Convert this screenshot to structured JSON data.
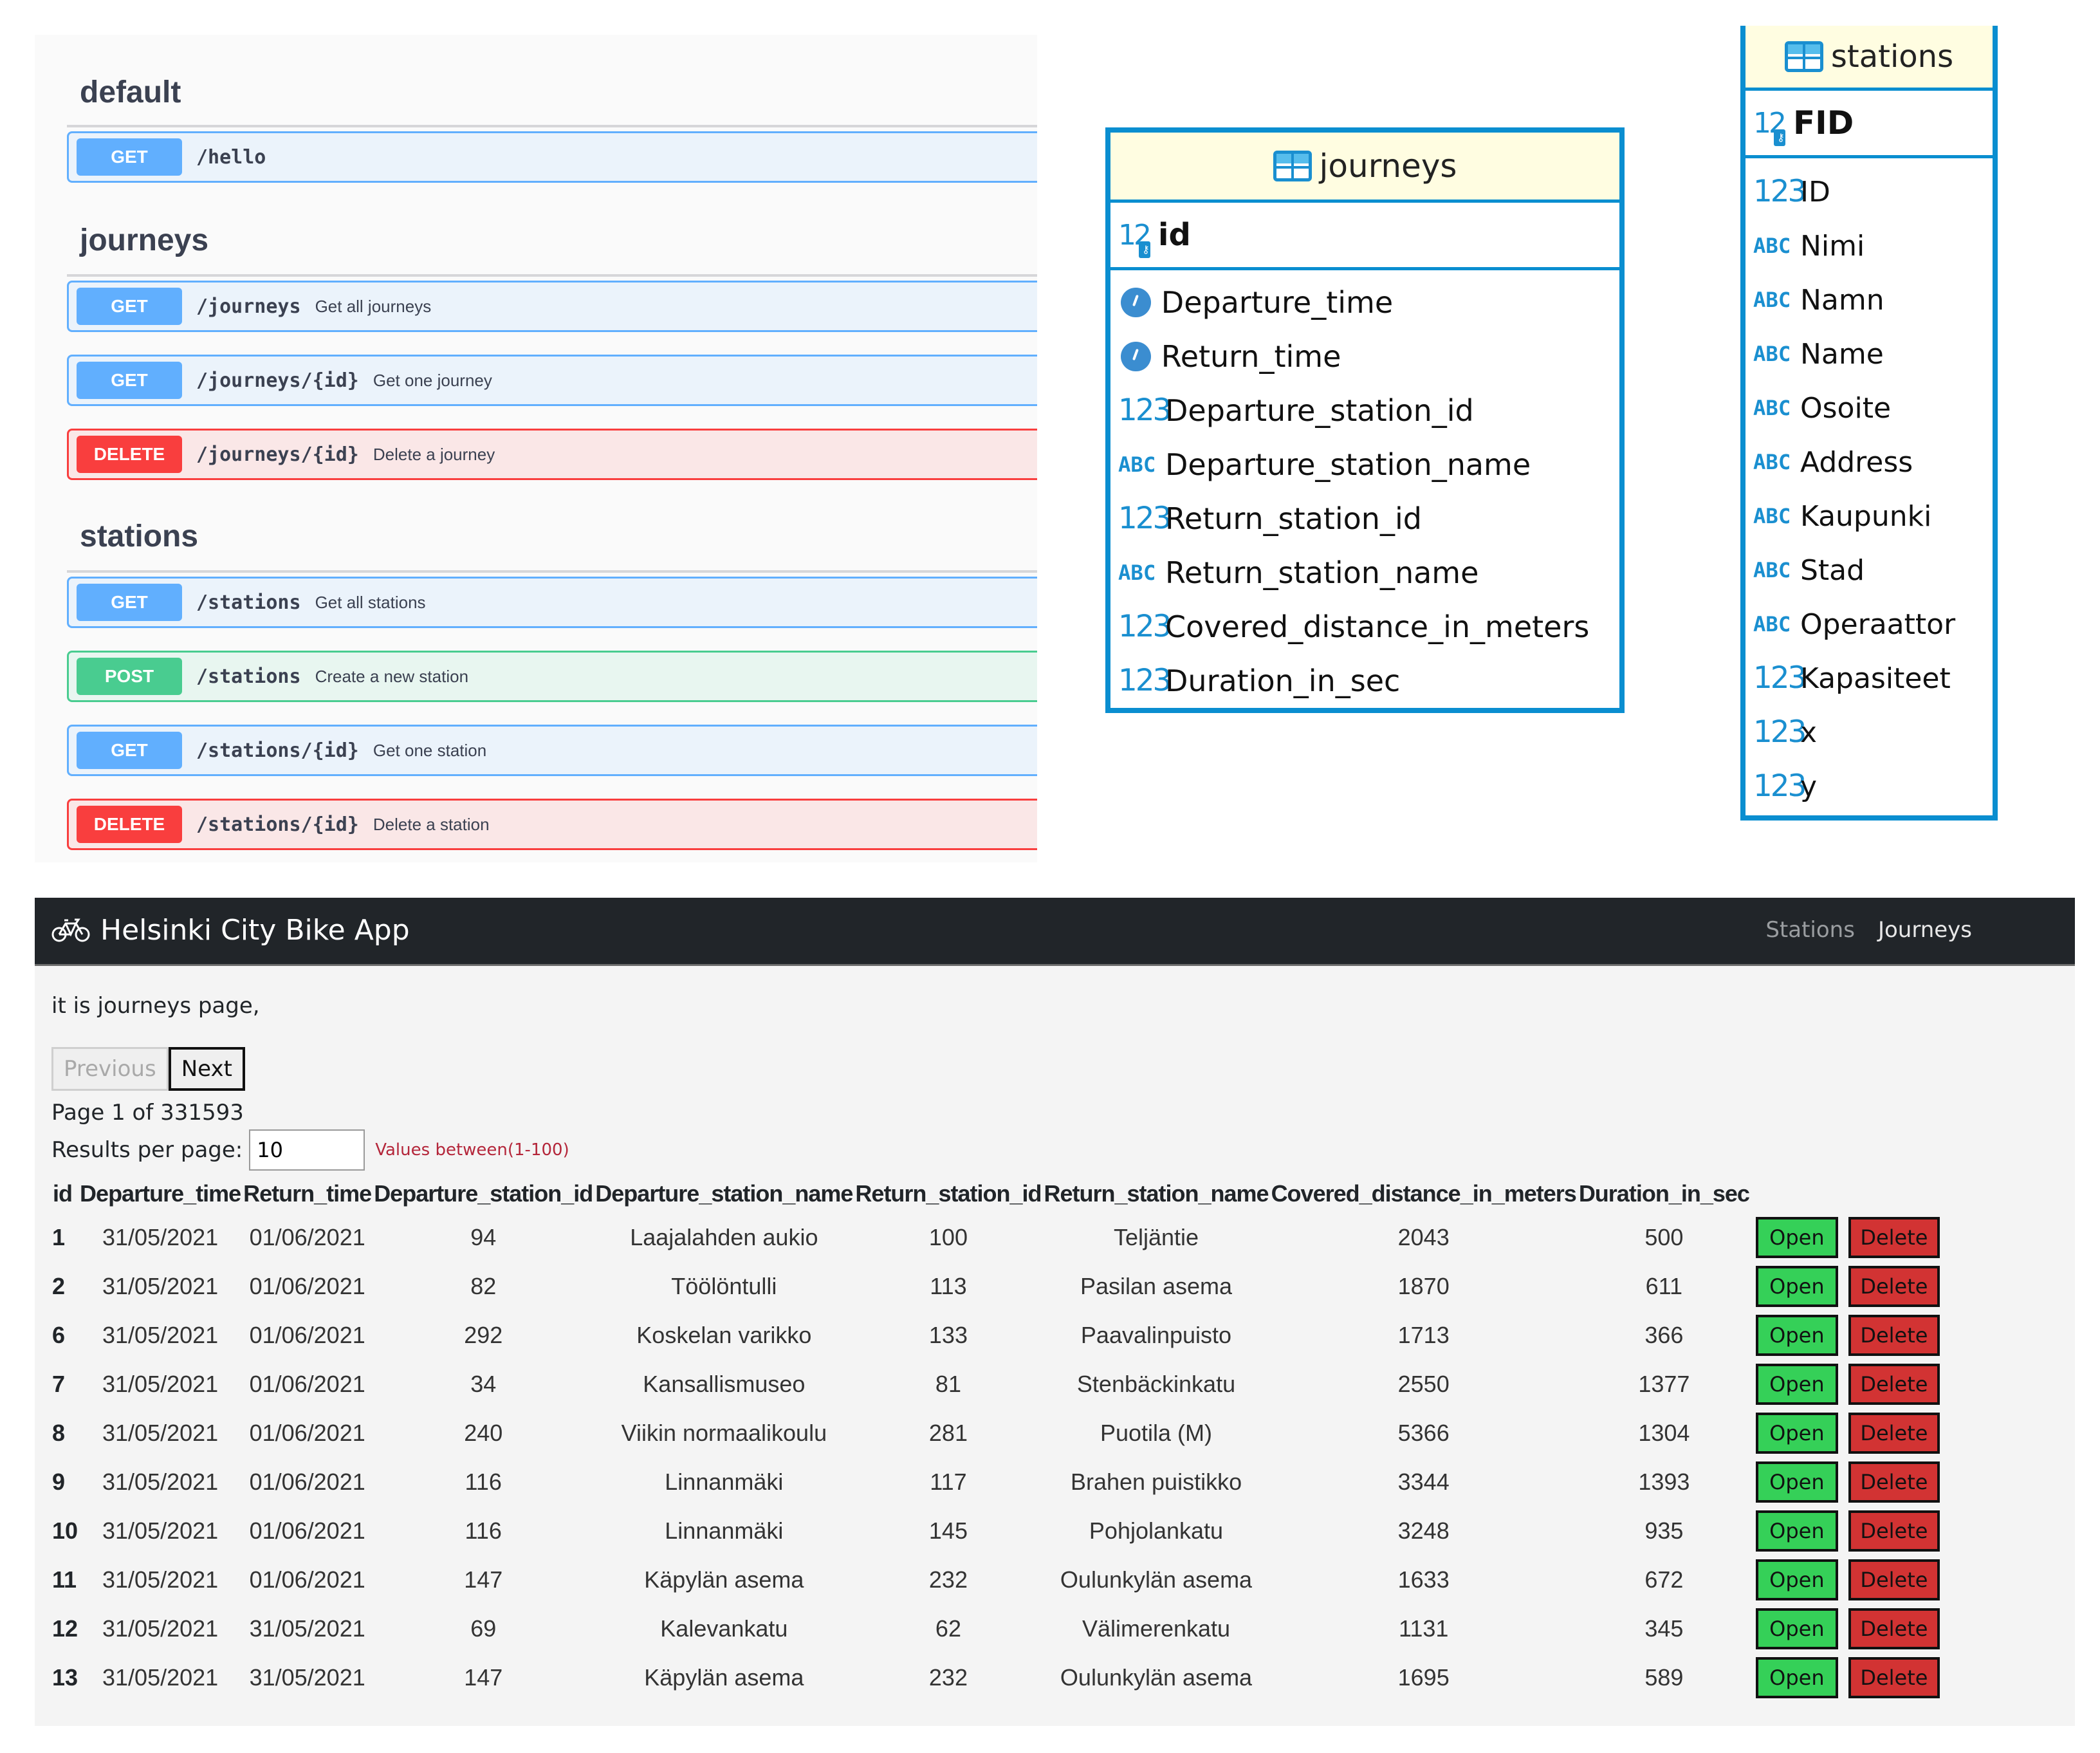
{
  "swagger": {
    "groups": [
      {
        "tag": "default",
        "operations": [
          {
            "method": "GET",
            "path": "/hello",
            "summary": ""
          }
        ]
      },
      {
        "tag": "journeys",
        "operations": [
          {
            "method": "GET",
            "path": "/journeys",
            "summary": "Get all journeys"
          },
          {
            "method": "GET",
            "path": "/journeys/{id}",
            "summary": "Get one journey"
          },
          {
            "method": "DELETE",
            "path": "/journeys/{id}",
            "summary": "Delete a journey"
          }
        ]
      },
      {
        "tag": "stations",
        "operations": [
          {
            "method": "GET",
            "path": "/stations",
            "summary": "Get all stations"
          },
          {
            "method": "POST",
            "path": "/stations",
            "summary": "Create a new station"
          },
          {
            "method": "GET",
            "path": "/stations/{id}",
            "summary": "Get one station"
          },
          {
            "method": "DELETE",
            "path": "/stations/{id}",
            "summary": "Delete a station"
          }
        ]
      }
    ]
  },
  "er": {
    "journeys": {
      "title": "journeys",
      "pk": {
        "type": "123",
        "name": "id"
      },
      "columns": [
        {
          "type": "clock",
          "name": "Departure_time"
        },
        {
          "type": "clock",
          "name": "Return_time"
        },
        {
          "type": "123",
          "name": "Departure_station_id"
        },
        {
          "type": "ABC",
          "name": "Departure_station_name"
        },
        {
          "type": "123",
          "name": "Return_station_id"
        },
        {
          "type": "ABC",
          "name": "Return_station_name"
        },
        {
          "type": "123",
          "name": "Covered_distance_in_meters"
        },
        {
          "type": "123",
          "name": "Duration_in_sec"
        }
      ]
    },
    "stations": {
      "title": "stations",
      "pk": {
        "type": "123",
        "name": "FID"
      },
      "columns": [
        {
          "type": "123",
          "name": "ID"
        },
        {
          "type": "ABC",
          "name": "Nimi"
        },
        {
          "type": "ABC",
          "name": "Namn"
        },
        {
          "type": "ABC",
          "name": "Name"
        },
        {
          "type": "ABC",
          "name": "Osoite"
        },
        {
          "type": "ABC",
          "name": "Address"
        },
        {
          "type": "ABC",
          "name": "Kaupunki"
        },
        {
          "type": "ABC",
          "name": "Stad"
        },
        {
          "type": "ABC",
          "name": "Operaattor"
        },
        {
          "type": "123",
          "name": "Kapasiteet"
        },
        {
          "type": "123",
          "name": "x"
        },
        {
          "type": "123",
          "name": "y"
        }
      ]
    }
  },
  "app": {
    "brand": "Helsinki City Bike App",
    "brand_icon": "bicycle-icon",
    "nav": [
      {
        "label": "Stations",
        "active": false
      },
      {
        "label": "Journeys",
        "active": true
      }
    ],
    "intro": "it is journeys page,",
    "prev_label": "Previous",
    "next_label": "Next",
    "page_info": "Page 1 of 331593",
    "rpp_label": "Results per page:",
    "rpp_value": "10",
    "rpp_hint": "Values between(1-100)",
    "open_label": "Open",
    "delete_label": "Delete",
    "columns": [
      "id",
      "Departure_time",
      "Return_time",
      "Departure_station_id",
      "Departure_station_name",
      "Return_station_id",
      "Return_station_name",
      "Covered_distance_in_meters",
      "Duration_in_sec"
    ],
    "rows": [
      [
        "1",
        "31/05/2021",
        "01/06/2021",
        "94",
        "Laajalahden aukio",
        "100",
        "Teljäntie",
        "2043",
        "500"
      ],
      [
        "2",
        "31/05/2021",
        "01/06/2021",
        "82",
        "Töölöntulli",
        "113",
        "Pasilan asema",
        "1870",
        "611"
      ],
      [
        "6",
        "31/05/2021",
        "01/06/2021",
        "292",
        "Koskelan varikko",
        "133",
        "Paavalinpuisto",
        "1713",
        "366"
      ],
      [
        "7",
        "31/05/2021",
        "01/06/2021",
        "34",
        "Kansallismuseo",
        "81",
        "Stenbäckinkatu",
        "2550",
        "1377"
      ],
      [
        "8",
        "31/05/2021",
        "01/06/2021",
        "240",
        "Viikin normaalikoulu",
        "281",
        "Puotila (M)",
        "5366",
        "1304"
      ],
      [
        "9",
        "31/05/2021",
        "01/06/2021",
        "116",
        "Linnanmäki",
        "117",
        "Brahen puistikko",
        "3344",
        "1393"
      ],
      [
        "10",
        "31/05/2021",
        "01/06/2021",
        "116",
        "Linnanmäki",
        "145",
        "Pohjolankatu",
        "3248",
        "935"
      ],
      [
        "11",
        "31/05/2021",
        "01/06/2021",
        "147",
        "Käpylän asema",
        "232",
        "Oulunkylän asema",
        "1633",
        "672"
      ],
      [
        "12",
        "31/05/2021",
        "31/05/2021",
        "69",
        "Kalevankatu",
        "62",
        "Välimerenkatu",
        "1131",
        "345"
      ],
      [
        "13",
        "31/05/2021",
        "31/05/2021",
        "147",
        "Käpylän asema",
        "232",
        "Oulunkylän asema",
        "1695",
        "589"
      ]
    ]
  }
}
